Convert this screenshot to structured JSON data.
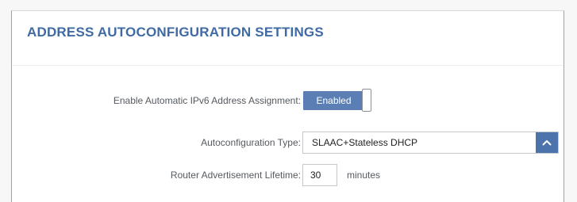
{
  "section": {
    "title": "ADDRESS AUTOCONFIGURATION SETTINGS"
  },
  "auto_assign": {
    "label": "Enable Automatic IPv6 Address Assignment:",
    "value": "Enabled"
  },
  "autoconfig_type": {
    "label": "Autoconfiguration Type:",
    "value": "SLAAC+Stateless DHCP",
    "button_icon": "chevron-up-icon"
  },
  "ra_lifetime": {
    "label": "Router Advertisement Lifetime:",
    "value": "30",
    "unit": "minutes"
  },
  "colors": {
    "title": "#3f6aa3",
    "toggle_on": "#5b7fb4",
    "select_button": "#4d73ad",
    "label_text": "#555a5f"
  }
}
